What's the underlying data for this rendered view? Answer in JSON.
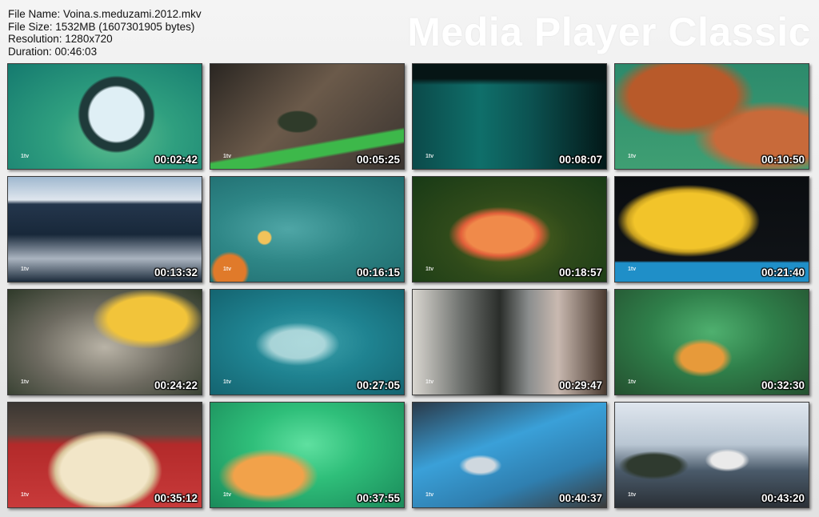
{
  "info": {
    "file_name": "File Name: Voina.s.meduzami.2012.mkv",
    "file_size": "File Size: 1532MB (1607301905 bytes)",
    "resolution": "Resolution: 1280x720",
    "duration": "Duration: 00:46:03"
  },
  "brand": "Media Player Classic",
  "thumbnails": [
    {
      "time": "00:02:42",
      "logo": "1tv",
      "scene": "underwater-tube"
    },
    {
      "time": "00:05:25",
      "logo": "1tv",
      "scene": "fisherman-boat"
    },
    {
      "time": "00:08:07",
      "logo": "1tv",
      "scene": "underwater-dark"
    },
    {
      "time": "00:10:50",
      "logo": "1tv",
      "scene": "octopus"
    },
    {
      "time": "00:13:32",
      "logo": "1tv",
      "scene": "ocean-waves"
    },
    {
      "time": "00:16:15",
      "logo": "1tv",
      "scene": "jellyfish-surface"
    },
    {
      "time": "00:18:57",
      "logo": "1tv",
      "scene": "orange-jellyfish"
    },
    {
      "time": "00:21:40",
      "logo": "1tv",
      "scene": "yellow-net"
    },
    {
      "time": "00:24:22",
      "logo": "1tv",
      "scene": "jellyfish-rock"
    },
    {
      "time": "00:27:05",
      "logo": "1tv",
      "scene": "comb-jelly"
    },
    {
      "time": "00:29:47",
      "logo": "1tv",
      "scene": "fish-closeup"
    },
    {
      "time": "00:32:30",
      "logo": "1tv",
      "scene": "green-net"
    },
    {
      "time": "00:35:12",
      "logo": "1tv",
      "scene": "noodle-bowl"
    },
    {
      "time": "00:37:55",
      "logo": "1tv",
      "scene": "net-underwater"
    },
    {
      "time": "00:40:37",
      "logo": "1tv",
      "scene": "blue-deck"
    },
    {
      "time": "00:43:20",
      "logo": "1tv",
      "scene": "fishermen-net"
    }
  ]
}
